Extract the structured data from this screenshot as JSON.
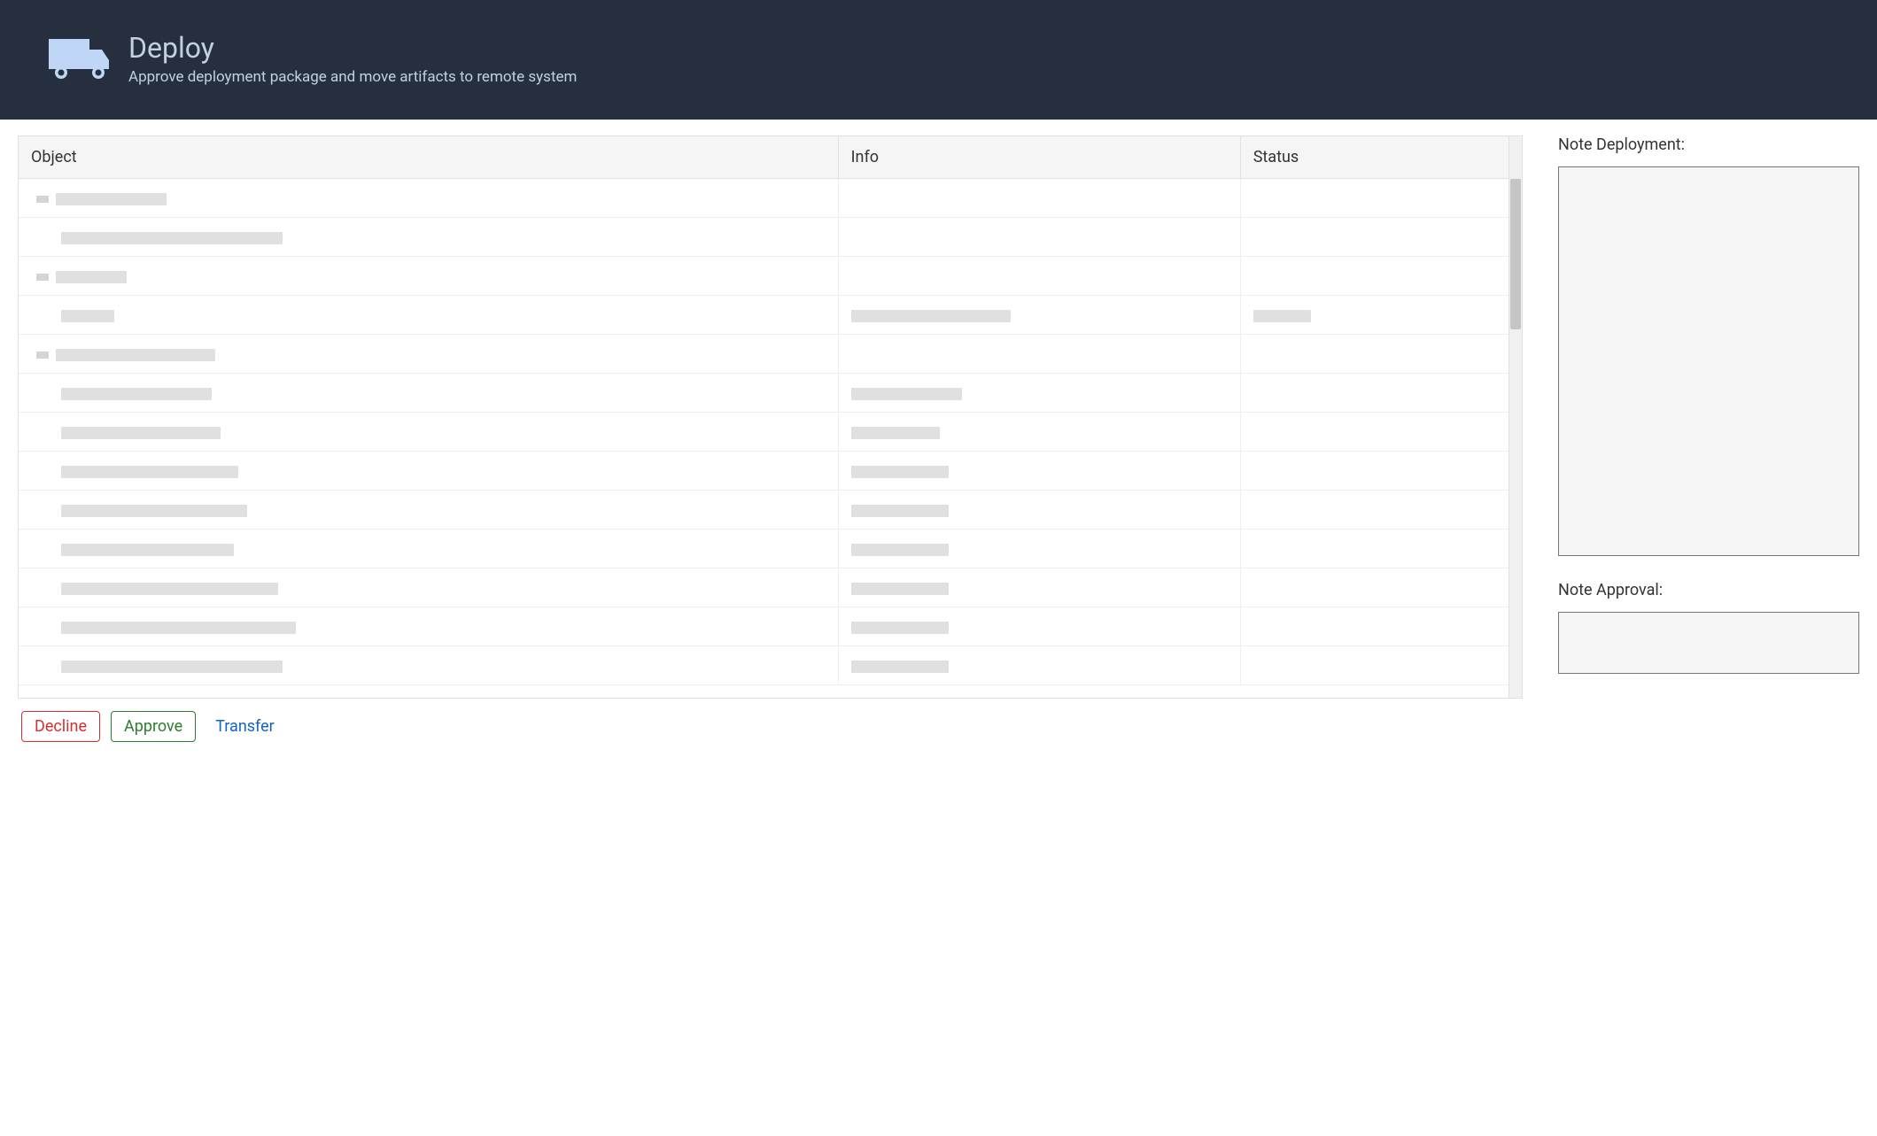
{
  "header": {
    "title": "Deploy",
    "subtitle": "Approve deployment package and move artifacts to remote system"
  },
  "table": {
    "columns": {
      "object": "Object",
      "info": "Info",
      "status": "Status"
    },
    "rows": [
      {
        "indent": 0,
        "expandable": true,
        "objectW": 125,
        "infoW": 0,
        "statusW": 0
      },
      {
        "indent": 1,
        "expandable": false,
        "objectW": 250,
        "infoW": 0,
        "statusW": 0
      },
      {
        "indent": 0,
        "expandable": true,
        "objectW": 80,
        "infoW": 0,
        "statusW": 0
      },
      {
        "indent": 1,
        "expandable": false,
        "objectW": 60,
        "infoW": 180,
        "statusW": 65
      },
      {
        "indent": 0,
        "expandable": true,
        "objectW": 180,
        "infoW": 0,
        "statusW": 0
      },
      {
        "indent": 1,
        "expandable": false,
        "objectW": 170,
        "infoW": 125,
        "statusW": 0
      },
      {
        "indent": 1,
        "expandable": false,
        "objectW": 180,
        "infoW": 100,
        "statusW": 0
      },
      {
        "indent": 1,
        "expandable": false,
        "objectW": 200,
        "infoW": 110,
        "statusW": 0
      },
      {
        "indent": 1,
        "expandable": false,
        "objectW": 210,
        "infoW": 110,
        "statusW": 0
      },
      {
        "indent": 1,
        "expandable": false,
        "objectW": 195,
        "infoW": 110,
        "statusW": 0
      },
      {
        "indent": 1,
        "expandable": false,
        "objectW": 245,
        "infoW": 110,
        "statusW": 0
      },
      {
        "indent": 1,
        "expandable": false,
        "objectW": 265,
        "infoW": 110,
        "statusW": 0
      },
      {
        "indent": 1,
        "expandable": false,
        "objectW": 250,
        "infoW": 110,
        "statusW": 0
      }
    ]
  },
  "side": {
    "deployment_label": "Note Deployment:",
    "approval_label": "Note Approval:",
    "deployment_value": "",
    "approval_value": ""
  },
  "actions": {
    "decline": "Decline",
    "approve": "Approve",
    "transfer": "Transfer"
  }
}
